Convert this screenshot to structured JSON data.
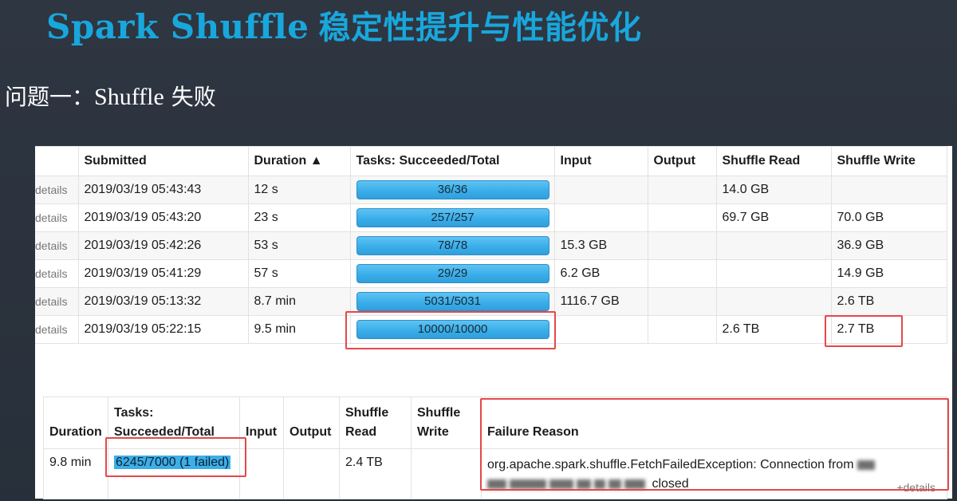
{
  "title": {
    "latin": "Spark Shuffle",
    "cjk": "稳定性提升与性能优化"
  },
  "subtitle": {
    "cjk": "问题一：",
    "latin": "Shuffle",
    "cjk2": " 失败"
  },
  "stage_table": {
    "headers": {
      "submitted": "Submitted",
      "duration": "Duration ▲",
      "tasks": "Tasks: Succeeded/Total",
      "input": "Input",
      "output": "Output",
      "shuffle_read": "Shuffle Read",
      "shuffle_write": "Shuffle Write"
    },
    "rows": [
      {
        "details": "details",
        "submitted": "2019/03/19 05:43:43",
        "duration": "12 s",
        "tasks": "36/36",
        "input": "",
        "output": "",
        "shuffle_read": "14.0 GB",
        "shuffle_write": ""
      },
      {
        "details": "details",
        "submitted": "2019/03/19 05:43:20",
        "duration": "23 s",
        "tasks": "257/257",
        "input": "",
        "output": "",
        "shuffle_read": "69.7 GB",
        "shuffle_write": "70.0 GB"
      },
      {
        "details": "details",
        "submitted": "2019/03/19 05:42:26",
        "duration": "53 s",
        "tasks": "78/78",
        "input": "15.3 GB",
        "output": "",
        "shuffle_read": "",
        "shuffle_write": "36.9 GB"
      },
      {
        "details": "details",
        "submitted": "2019/03/19 05:41:29",
        "duration": "57 s",
        "tasks": "29/29",
        "input": "6.2 GB",
        "output": "",
        "shuffle_read": "",
        "shuffle_write": "14.9 GB"
      },
      {
        "details": "details",
        "submitted": "2019/03/19 05:13:32",
        "duration": "8.7 min",
        "tasks": "5031/5031",
        "input": "1116.7 GB",
        "output": "",
        "shuffle_read": "",
        "shuffle_write": "2.6 TB"
      },
      {
        "details": "details",
        "submitted": "2019/03/19 05:22:15",
        "duration": "9.5 min",
        "tasks": "10000/10000",
        "input": "",
        "output": "",
        "shuffle_read": "2.6 TB",
        "shuffle_write": "2.7 TB"
      }
    ]
  },
  "task_table": {
    "headers": {
      "duration": "Duration",
      "tasks_line1": "Tasks:",
      "tasks_line2": "Succeeded/Total",
      "input": "Input",
      "output": "Output",
      "shuffle_read_1": "Shuffle",
      "shuffle_read_2": "Read",
      "shuffle_write_1": "Shuffle",
      "shuffle_write_2": "Write",
      "failure_reason": "Failure Reason"
    },
    "row": {
      "duration": "9.8 min",
      "tasks": "6245/7000 (1 failed)",
      "input": "",
      "output": "",
      "shuffle_read": "2.4 TB",
      "shuffle_write": "",
      "reason_line1": "org.apache.spark.shuffle.FetchFailedException: Connection from",
      "reason_line2": "closed",
      "more_link": "+details"
    }
  },
  "colors": {
    "title": "#18a7dc",
    "progress_bar": "#3aaeea",
    "highlight_box": "#e5484a",
    "background": "#2b323d"
  }
}
